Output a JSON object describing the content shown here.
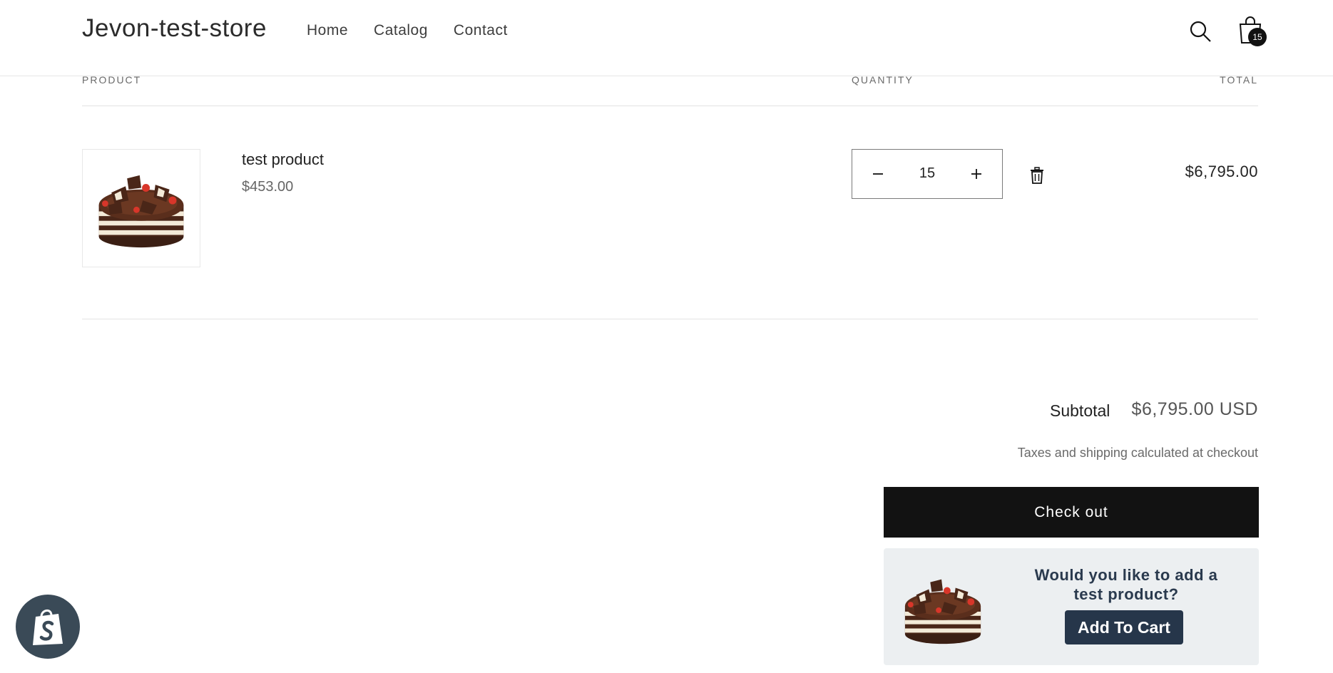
{
  "header": {
    "logo": "Jevon-test-store",
    "nav": [
      "Home",
      "Catalog",
      "Contact"
    ],
    "cart_count": "15"
  },
  "table": {
    "headers": {
      "product": "PRODUCT",
      "quantity": "QUANTITY",
      "total": "TOTAL"
    }
  },
  "line_item": {
    "name": "test product",
    "price": "$453.00",
    "quantity": "15",
    "total": "$6,795.00"
  },
  "summary": {
    "subtotal_label": "Subtotal",
    "subtotal_value": "$6,795.00 USD",
    "tax_note": "Taxes and shipping calculated at checkout",
    "checkout_label": "Check out"
  },
  "upsell": {
    "question": "Would you like to add a test product?",
    "button": "Add To Cart"
  },
  "icons": {
    "search": "search-icon",
    "cart": "shopping-bag-icon",
    "minus": "minus-icon",
    "plus": "plus-icon",
    "delete": "trash-icon",
    "shopify": "shopify-bag-icon"
  },
  "colors": {
    "checkout_bg": "#121212",
    "upsell_bg": "#eceff1",
    "upsell_button": "#26364a",
    "badge_bg": "#3a4a57"
  }
}
